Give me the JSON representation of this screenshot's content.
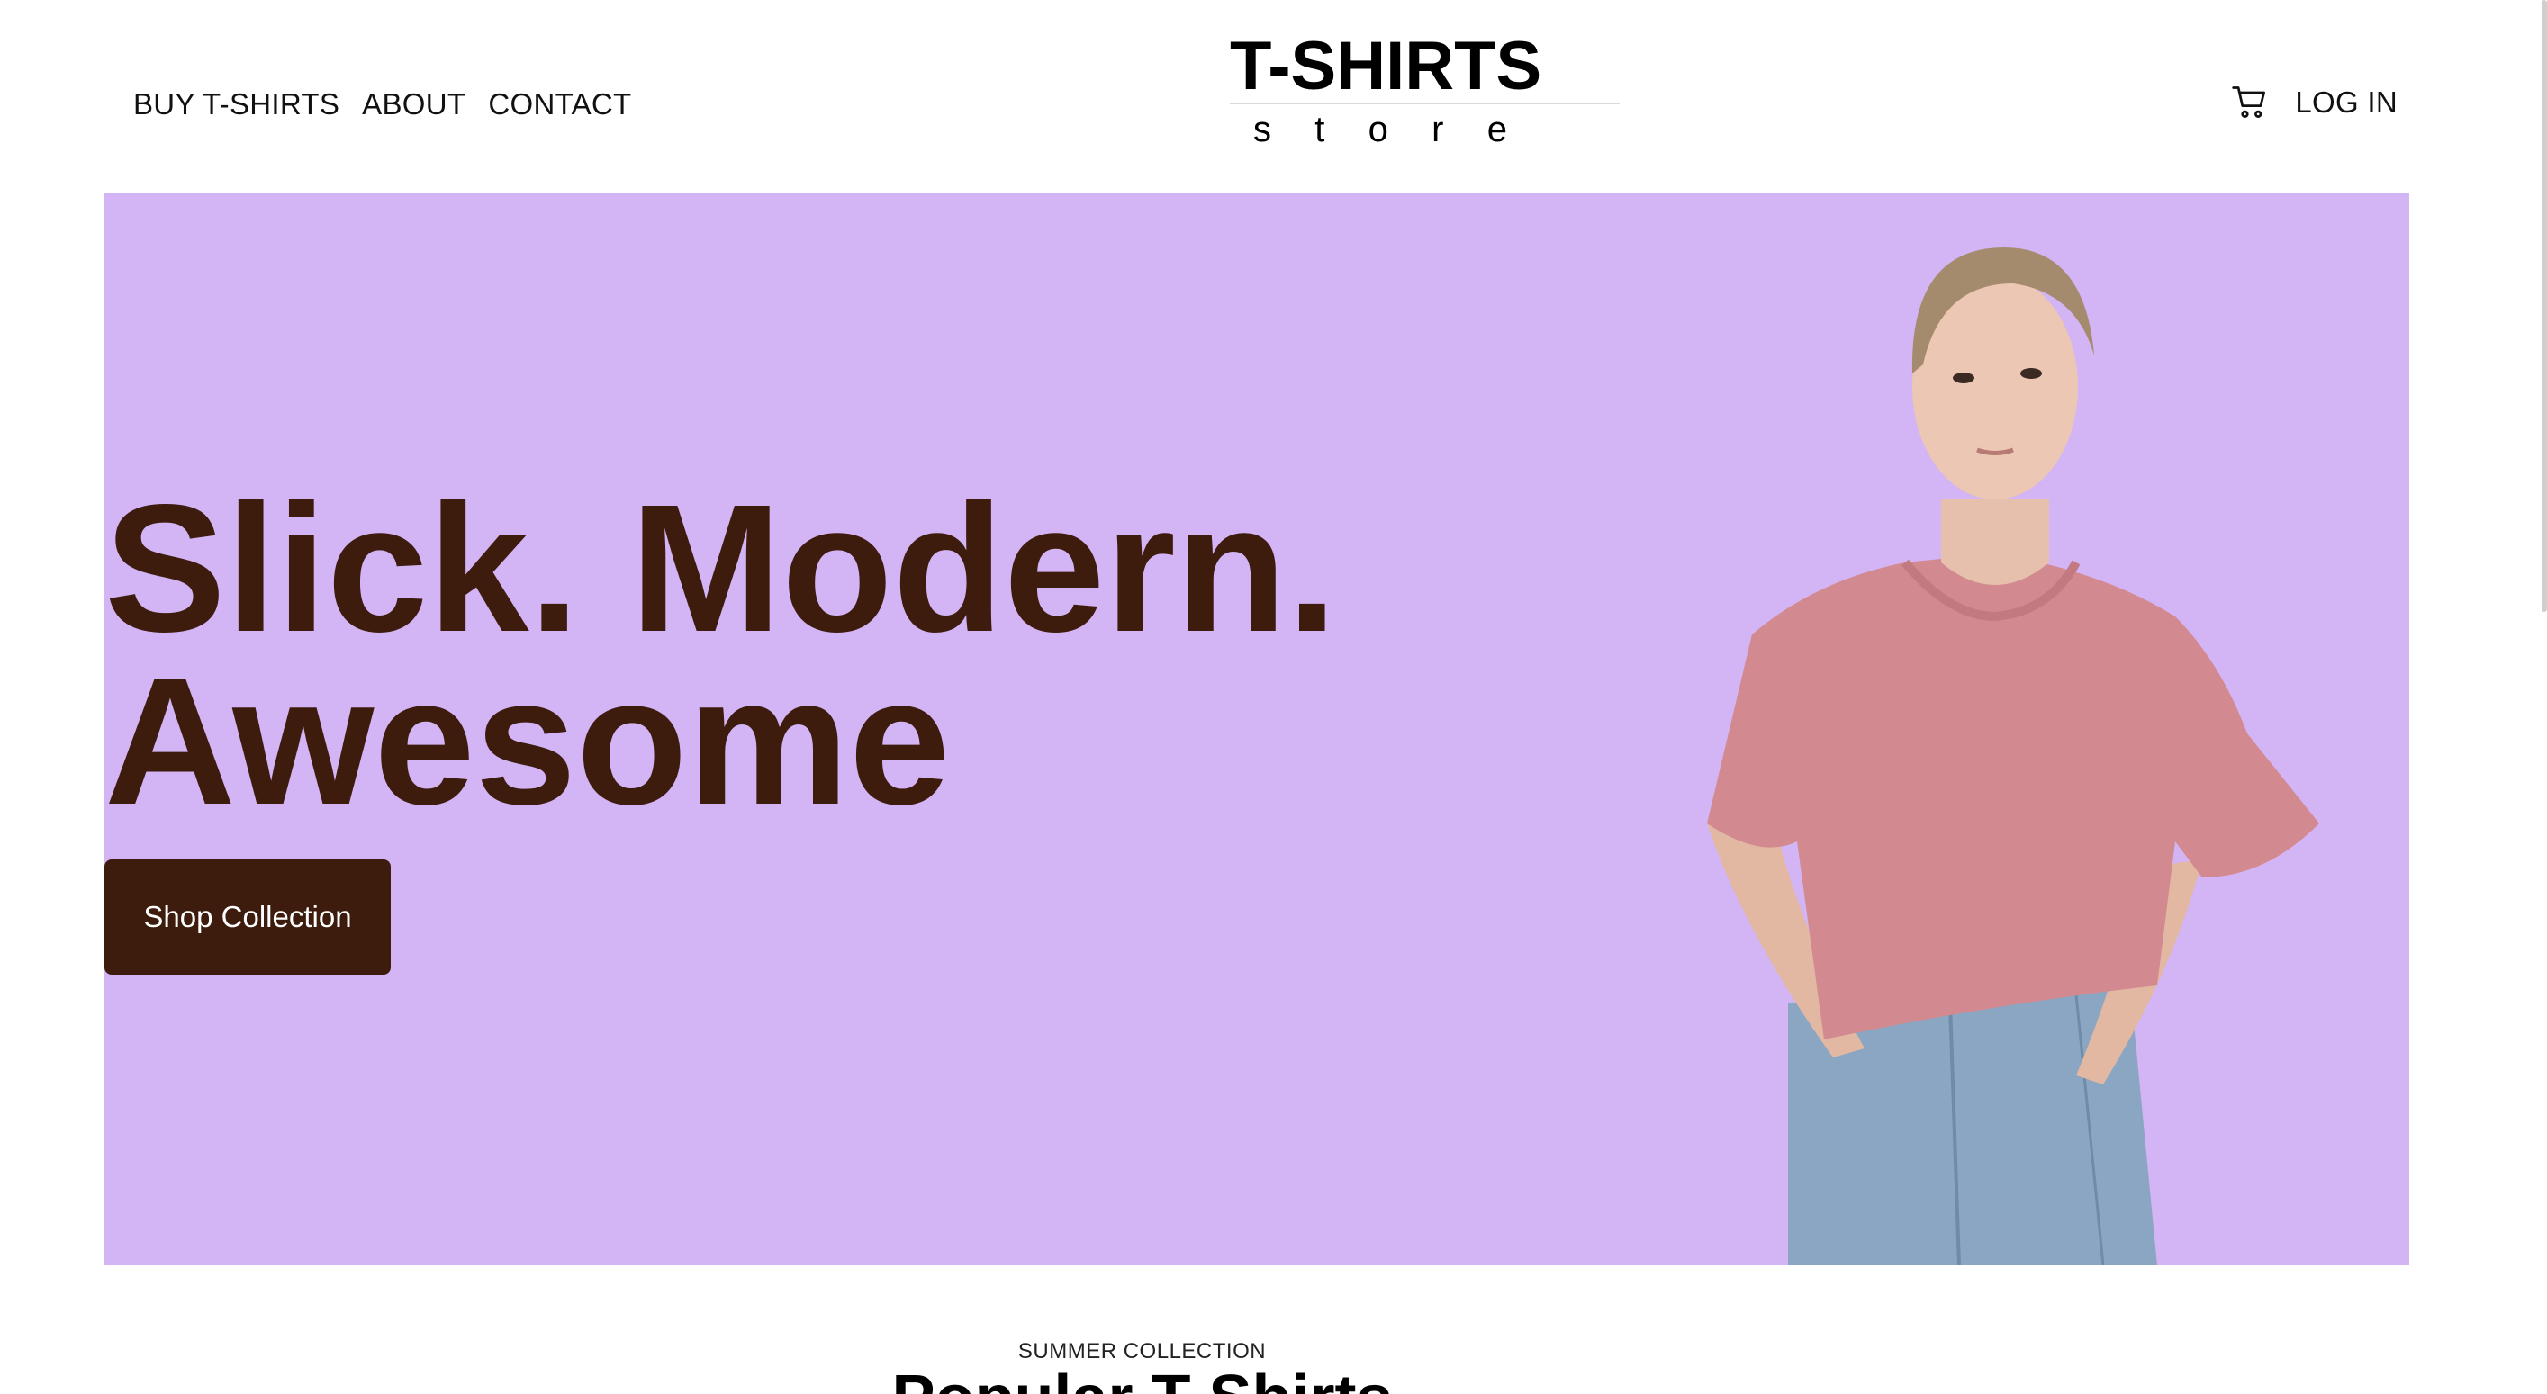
{
  "header": {
    "nav_left": [
      {
        "label": "BUY T-SHIRTS"
      },
      {
        "label": "ABOUT"
      },
      {
        "label": "CONTACT"
      }
    ],
    "logo": {
      "title": "T-SHIRTS",
      "subtitle_letters": [
        "s",
        "t",
        "o",
        "r",
        "e"
      ]
    },
    "cart_icon": "cart-icon",
    "login_label": "LOG IN"
  },
  "hero": {
    "headline_line1": "Slick. Modern.",
    "headline_line2": "Awesome",
    "cta_label": "Shop Collection",
    "background_color": "#d3b4f5",
    "text_color": "#3d1c0d",
    "model_image": "woman-in-pink-oversized-tshirt-and-jeans"
  },
  "collection": {
    "eyebrow": "SUMMER COLLECTION",
    "title": "Popular T-Shirts"
  }
}
